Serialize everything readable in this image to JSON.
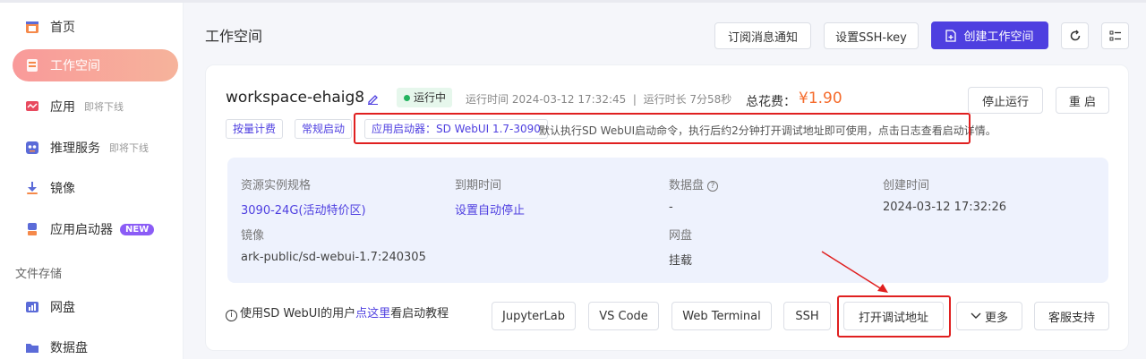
{
  "sidebar": {
    "items": [
      {
        "label": "首页",
        "icon": "home-icon"
      },
      {
        "label": "工作空间",
        "icon": "workspace-icon",
        "active": true
      },
      {
        "label": "应用",
        "sub": "即将下线",
        "icon": "app-icon"
      },
      {
        "label": "推理服务",
        "sub": "即将下线",
        "icon": "inference-icon"
      },
      {
        "label": "镜像",
        "icon": "image-icon"
      },
      {
        "label": "应用启动器",
        "badge": "NEW",
        "icon": "launcher-icon"
      }
    ],
    "section_title": "文件存储",
    "storage_items": [
      {
        "label": "网盘",
        "icon": "cloud-drive-icon"
      },
      {
        "label": "数据盘",
        "icon": "data-disk-icon"
      }
    ]
  },
  "header": {
    "title": "工作空间",
    "subscribe_label": "订阅消息通知",
    "ssh_key_label": "设置SSH-key",
    "create_label": "创建工作空间"
  },
  "workspace": {
    "name": "workspace-ehaig8",
    "dash": "-",
    "status": "运行中",
    "meta": "运行时间 2024-03-12 17:32:45  |  运行时长 7分58秒",
    "cost_label": "总花费：",
    "cost_value": "¥1.90",
    "stop_label": "停止运行",
    "restart_label": "重 启",
    "tags": {
      "billing": "按量计费",
      "startup": "常规启动",
      "launcher": "应用启动器：SD WebUI 1.7-3090"
    },
    "hint": "默认执行SD WebUI启动命令，执行后约2分钟打开调试地址即可使用，点击日志查看启动详情。",
    "info": {
      "spec_label": "资源实例规格",
      "spec_value": "3090-24G(活动特价区)",
      "expire_label": "到期时间",
      "expire_value": "设置自动停止",
      "disk_label": "数据盘",
      "disk_value": "-",
      "created_label": "创建时间",
      "created_value": "2024-03-12 17:32:26",
      "image_label": "镜像",
      "image_value": "ark-public/sd-webui-1.7:240305",
      "netdisk_label": "网盘",
      "netdisk_value": "挂载"
    },
    "footnote_prefix": "使用SD WebUI的用户",
    "footnote_link": "点这里",
    "footnote_suffix": "看启动教程",
    "actions": {
      "jupyter": "JupyterLab",
      "vscode": "VS Code",
      "terminal": "Web Terminal",
      "ssh": "SSH",
      "debug": "打开调试地址",
      "more": "更多",
      "support": "客服支持"
    }
  },
  "colors": {
    "accent": "#4e3fe0",
    "annotation_red": "#e02020",
    "cost": "#f56c2d"
  }
}
